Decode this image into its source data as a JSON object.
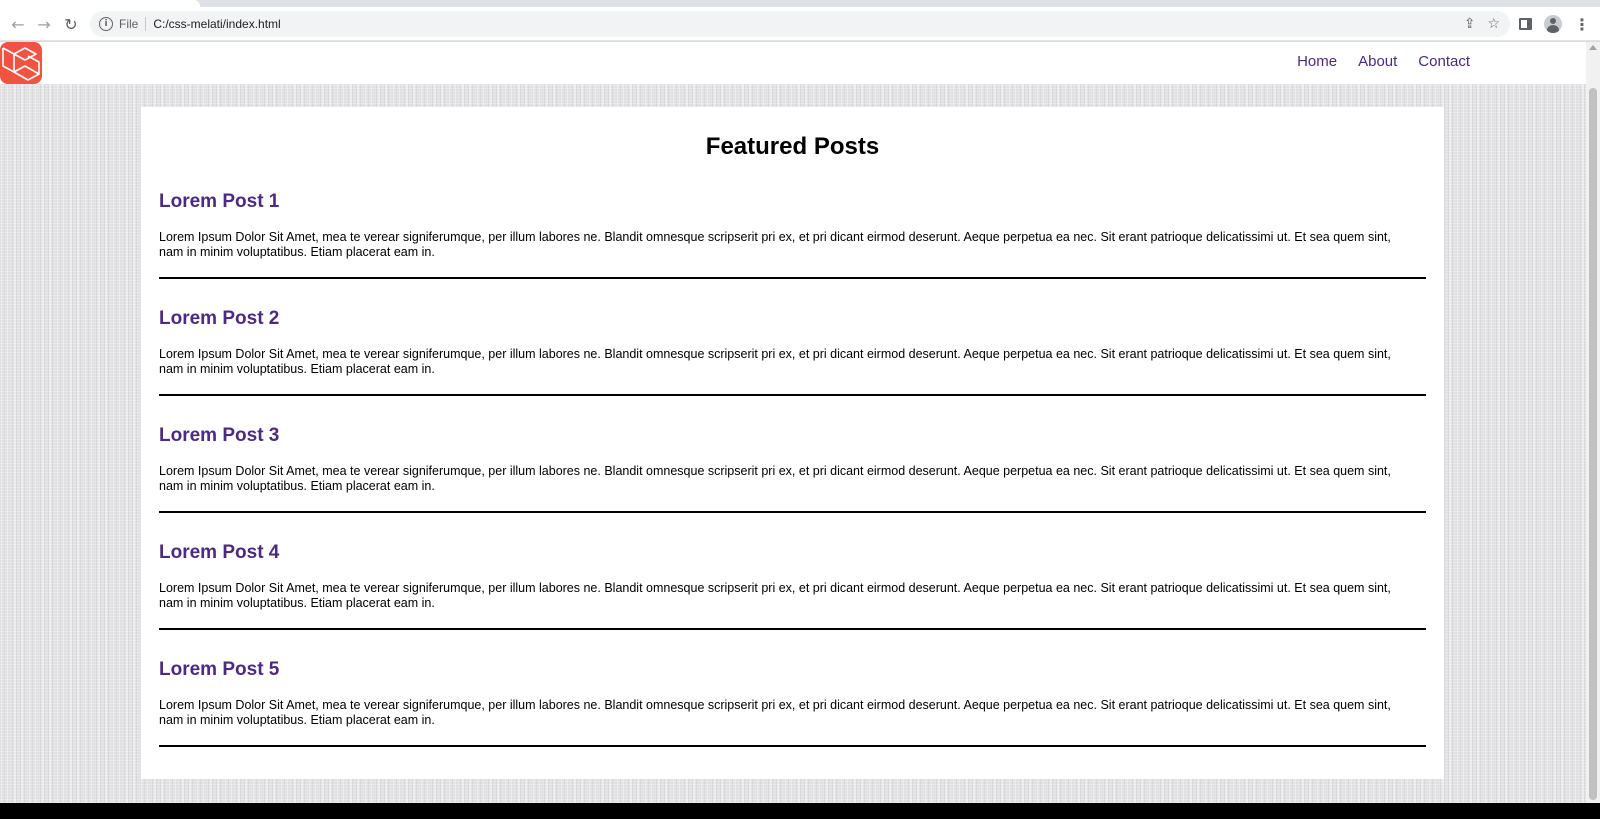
{
  "browser": {
    "url_scheme": "File",
    "url": "C:/css-melati/index.html",
    "icons": [
      "back-icon",
      "forward-icon",
      "reload-icon",
      "info-icon",
      "share-icon",
      "star-icon",
      "side-panel-icon",
      "profile-icon",
      "menu-icon"
    ]
  },
  "site": {
    "nav": [
      {
        "label": "Home"
      },
      {
        "label": "About"
      },
      {
        "label": "Contact"
      }
    ],
    "logo_color": "#f05340",
    "accent_color": "#4b2b7f"
  },
  "main": {
    "title": "Featured Posts",
    "posts": [
      {
        "title": "Lorem Post 1",
        "body": "Lorem Ipsum Dolor Sit Amet, mea te verear signiferumque, per illum labores ne. Blandit omnesque scripserit pri ex, et pri dicant eirmod deserunt. Aeque perpetua ea nec. Sit erant patrioque delicatissimi ut. Et sea quem sint, nam in minim voluptatibus. Etiam placerat eam in."
      },
      {
        "title": "Lorem Post 2",
        "body": "Lorem Ipsum Dolor Sit Amet, mea te verear signiferumque, per illum labores ne. Blandit omnesque scripserit pri ex, et pri dicant eirmod deserunt. Aeque perpetua ea nec. Sit erant patrioque delicatissimi ut. Et sea quem sint, nam in minim voluptatibus. Etiam placerat eam in."
      },
      {
        "title": "Lorem Post 3",
        "body": "Lorem Ipsum Dolor Sit Amet, mea te verear signiferumque, per illum labores ne. Blandit omnesque scripserit pri ex, et pri dicant eirmod deserunt. Aeque perpetua ea nec. Sit erant patrioque delicatissimi ut. Et sea quem sint, nam in minim voluptatibus. Etiam placerat eam in."
      },
      {
        "title": "Lorem Post 4",
        "body": "Lorem Ipsum Dolor Sit Amet, mea te verear signiferumque, per illum labores ne. Blandit omnesque scripserit pri ex, et pri dicant eirmod deserunt. Aeque perpetua ea nec. Sit erant patrioque delicatissimi ut. Et sea quem sint, nam in minim voluptatibus. Etiam placerat eam in."
      },
      {
        "title": "Lorem Post 5",
        "body": "Lorem Ipsum Dolor Sit Amet, mea te verear signiferumque, per illum labores ne. Blandit omnesque scripserit pri ex, et pri dicant eirmod deserunt. Aeque perpetua ea nec. Sit erant patrioque delicatissimi ut. Et sea quem sint, nam in minim voluptatibus. Etiam placerat eam in."
      }
    ]
  }
}
